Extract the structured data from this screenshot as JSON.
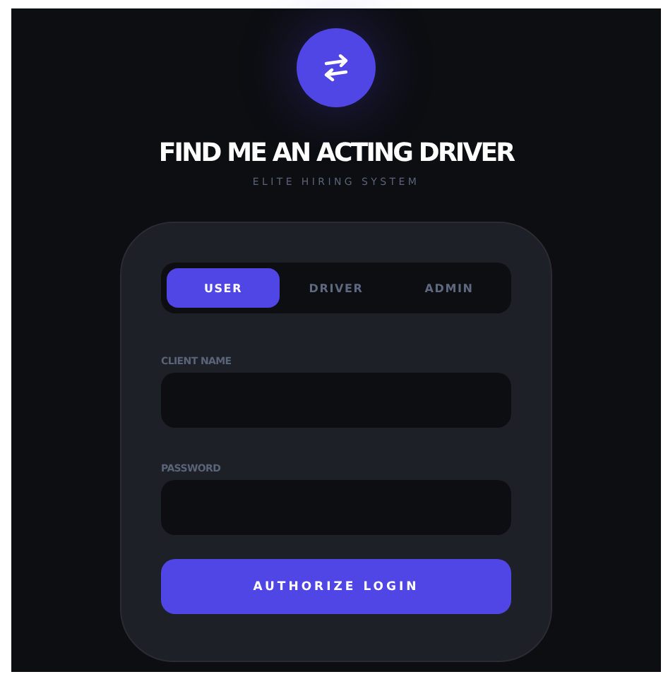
{
  "header": {
    "title": "FIND ME AN ACTING DRIVER",
    "subtitle": "ELITE HIRING SYSTEM"
  },
  "tabs": [
    {
      "label": "USER",
      "selected": true
    },
    {
      "label": "DRIVER",
      "selected": false
    },
    {
      "label": "ADMIN",
      "selected": false
    }
  ],
  "fields": [
    {
      "label": "CLIENT NAME"
    },
    {
      "label": "PASSWORD"
    }
  ],
  "submit": {
    "label": "AUTHORIZE LOGIN"
  }
}
